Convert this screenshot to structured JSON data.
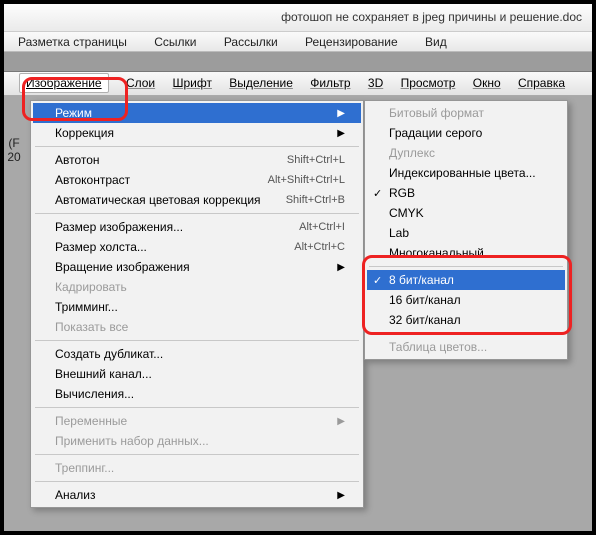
{
  "window": {
    "title": "фотошоп не сохраняет в jpeg причины и решение.doc"
  },
  "main_tabs": [
    "Разметка страницы",
    "Ссылки",
    "Рассылки",
    "Рецензирование",
    "Вид"
  ],
  "menubar": {
    "items": [
      "Изображение",
      "Слои",
      "Шрифт",
      "Выделение",
      "Фильтр",
      "3D",
      "Просмотр",
      "Окно",
      "Справка"
    ],
    "active_index": 0
  },
  "left_gutter": [
    "(F",
    "20"
  ],
  "dropdown_image": {
    "groups": [
      [
        {
          "label": "Режим",
          "arrow": true,
          "hl": true
        },
        {
          "label": "Коррекция",
          "arrow": true
        }
      ],
      [
        {
          "label": "Автотон",
          "shortcut": "Shift+Ctrl+L"
        },
        {
          "label": "Автоконтраст",
          "shortcut": "Alt+Shift+Ctrl+L"
        },
        {
          "label": "Автоматическая цветовая коррекция",
          "shortcut": "Shift+Ctrl+B"
        }
      ],
      [
        {
          "label": "Размер изображения...",
          "shortcut": "Alt+Ctrl+I"
        },
        {
          "label": "Размер холста...",
          "shortcut": "Alt+Ctrl+C"
        },
        {
          "label": "Вращение изображения",
          "arrow": true
        },
        {
          "label": "Кадрировать",
          "disabled": true
        },
        {
          "label": "Тримминг..."
        },
        {
          "label": "Показать все",
          "disabled": true
        }
      ],
      [
        {
          "label": "Создать дубликат..."
        },
        {
          "label": "Внешний канал..."
        },
        {
          "label": "Вычисления..."
        }
      ],
      [
        {
          "label": "Переменные",
          "arrow": true,
          "disabled": true
        },
        {
          "label": "Применить набор данных...",
          "disabled": true
        }
      ],
      [
        {
          "label": "Треппинг...",
          "disabled": true
        }
      ],
      [
        {
          "label": "Анализ",
          "arrow": true
        }
      ]
    ]
  },
  "dropdown_mode": {
    "groups": [
      [
        {
          "label": "Битовый формат",
          "disabled": true
        },
        {
          "label": "Градации серого"
        },
        {
          "label": "Дуплекс",
          "disabled": true
        },
        {
          "label": "Индексированные цвета..."
        },
        {
          "label": "RGB",
          "checked": true
        },
        {
          "label": "CMYK"
        },
        {
          "label": "Lab"
        },
        {
          "label": "Многоканальный"
        }
      ],
      [
        {
          "label": "8 бит/канал",
          "checked": true,
          "hl": true
        },
        {
          "label": "16 бит/канал"
        },
        {
          "label": "32 бит/канал"
        }
      ],
      [
        {
          "label": "Таблица цветов...",
          "disabled": true
        }
      ]
    ]
  }
}
